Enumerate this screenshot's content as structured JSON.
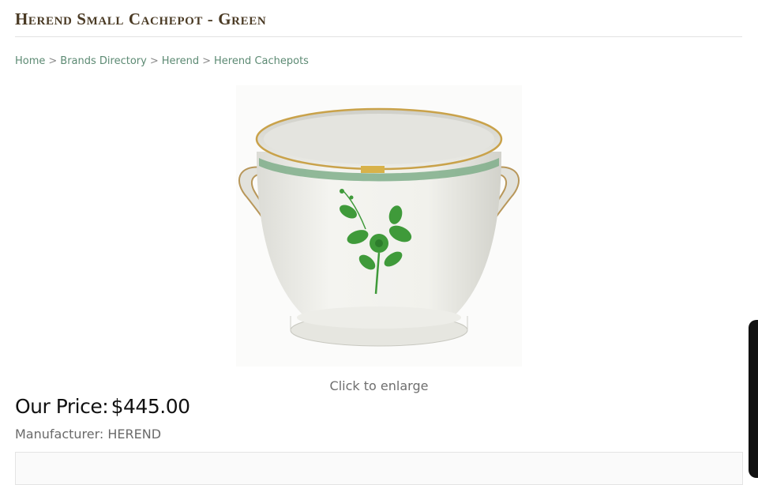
{
  "page": {
    "title": "Herend Small Cachepot - Green"
  },
  "breadcrumb": {
    "items": [
      "Home",
      "Brands Directory",
      "Herend",
      "Herend Cachepots"
    ],
    "separator": ">"
  },
  "product": {
    "image_alt_icon": "cachepot-image",
    "enlarge_label": "Click to enlarge",
    "price_label": "Our Price:",
    "price_value": "$445.00",
    "manufacturer_label": "Manufacturer:",
    "manufacturer_value": "HEREND"
  },
  "colors": {
    "title": "#4a3a24",
    "link": "#5c8a73",
    "accent_green": "#3f9a3a",
    "gold": "#c9a24a"
  }
}
